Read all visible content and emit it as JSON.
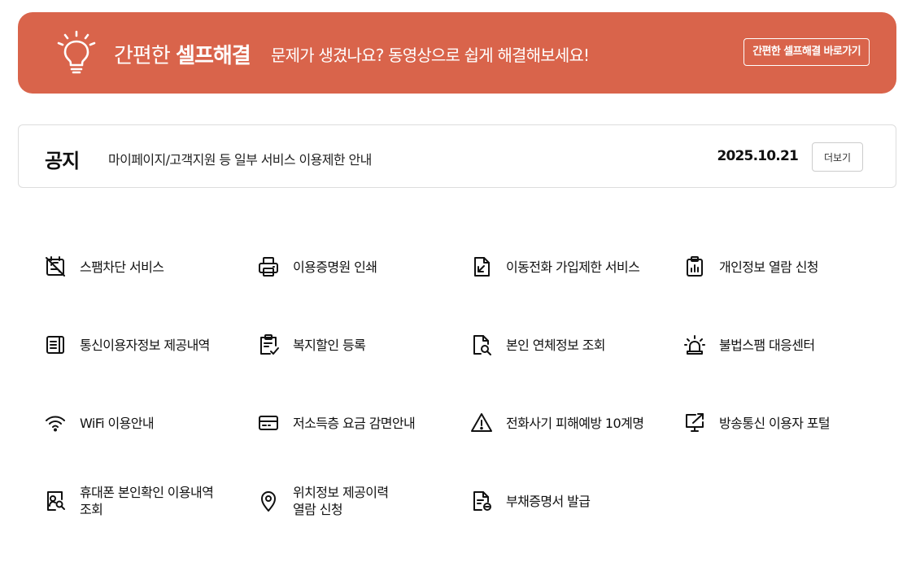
{
  "colors": {
    "accent": "#d9644b",
    "text": "#111111",
    "border": "#dddddd"
  },
  "banner": {
    "icon": "lightbulb-icon",
    "title_prefix": "간편한",
    "title_bold": "셀프해결",
    "subtitle": "문제가 생겼나요? 동영상으로 쉽게 해결해보세요!",
    "cta_label": "간편한 셀프해결 바로가기"
  },
  "notice": {
    "label": "공지",
    "text": "마이페이지/고객지원 등 일부 서비스 이용제한 안내",
    "date": "2025.10.21",
    "more_label": "더보기"
  },
  "services": [
    {
      "label": "스팸차단 서비스",
      "icon": "spam-block-icon"
    },
    {
      "label": "이용증명원 인쇄",
      "icon": "printer-icon"
    },
    {
      "label": "이동전화 가입제한 서비스",
      "icon": "document-restrict-icon"
    },
    {
      "label": "개인정보 열람 신청",
      "icon": "clipboard-chart-icon"
    },
    {
      "label": "통신이용자정보 제공내역",
      "icon": "document-list-icon"
    },
    {
      "label": "복지할인 등록",
      "icon": "clipboard-check-icon"
    },
    {
      "label": "본인 연체정보 조회",
      "icon": "document-search-icon"
    },
    {
      "label": "불법스팸 대응센터",
      "icon": "siren-icon"
    },
    {
      "label": "WiFi 이용안내",
      "icon": "wifi-icon"
    },
    {
      "label": "저소득층 요금 감면안내",
      "icon": "card-icon"
    },
    {
      "label": "전화사기 피해예방 10계명",
      "icon": "warning-icon"
    },
    {
      "label": "방송통신 이용자 포털",
      "icon": "monitor-link-icon"
    },
    {
      "label": "휴대폰 본인확인 이용내역\n조회",
      "icon": "user-search-icon"
    },
    {
      "label": "위치정보 제공이력\n열람 신청",
      "icon": "location-pin-icon"
    },
    {
      "label": "부채증명서 발급",
      "icon": "document-minus-icon"
    }
  ]
}
